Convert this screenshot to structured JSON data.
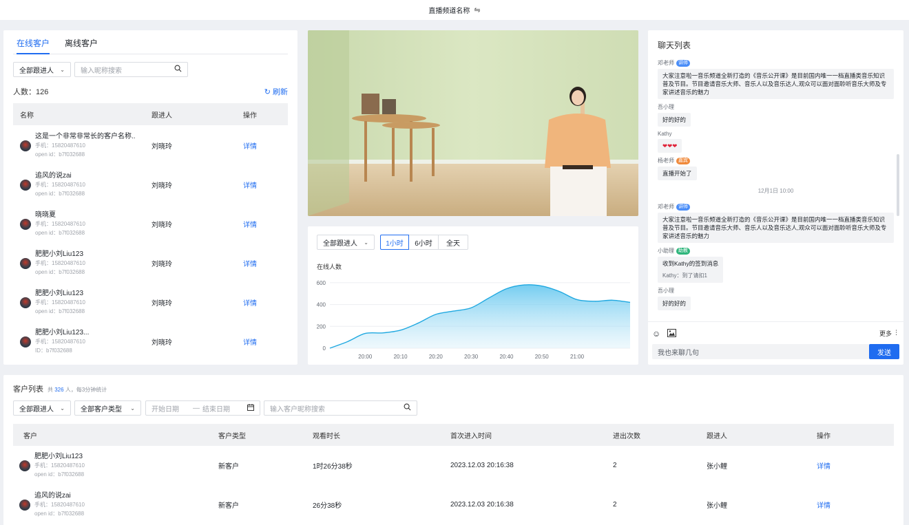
{
  "topbar": {
    "title": "直播频道名称",
    "switch_icon": "⇋"
  },
  "left": {
    "tabs": [
      "在线客户",
      "离线客户"
    ],
    "filter_select": "全部跟进人",
    "search_placeholder": "输入昵称搜索",
    "count_label": "人数：126",
    "refresh_label": "刷新",
    "headers": [
      "名称",
      "跟进人",
      "操作"
    ],
    "rows": [
      {
        "name": "这是一个非常非常长的客户名称..",
        "phone": "手机：15820487610",
        "openid": "open id：b7f032688",
        "follower": "刘晓玲",
        "action": "详情"
      },
      {
        "name": "追风的说zai",
        "phone": "手机：15820487610",
        "openid": "open id：b7f032688",
        "follower": "刘晓玲",
        "action": "详情"
      },
      {
        "name": "晓晓夏",
        "phone": "手机：15820487610",
        "openid": "open id：b7f032688",
        "follower": "刘晓玲",
        "action": "详情"
      },
      {
        "name": "肥肥小刘Liu123",
        "phone": "手机：15820487610",
        "openid": "open id：b7f032688",
        "follower": "刘晓玲",
        "action": "详情"
      },
      {
        "name": "肥肥小刘Liu123",
        "phone": "手机：15820487610",
        "openid": "open id：b7f032688",
        "follower": "刘晓玲",
        "action": "详情"
      },
      {
        "name": "肥肥小刘Liu123...",
        "phone": "手机：15820487610",
        "openid": "ID：b7f032688",
        "follower": "刘晓玲",
        "action": "详情"
      }
    ]
  },
  "chart_panel": {
    "filter_select": "全部跟进人",
    "segments": [
      "1小时",
      "6小时",
      "全天"
    ],
    "active_segment": "1小时"
  },
  "chart_data": {
    "type": "area",
    "title": "在线人数",
    "x_ticks": [
      "20:00",
      "20:10",
      "20:20",
      "20:30",
      "20:40",
      "20:50",
      "21:00"
    ],
    "y_ticks": [
      0,
      200,
      400,
      600
    ],
    "ylim": [
      0,
      650
    ],
    "x": [
      "19:50",
      "19:55",
      "20:00",
      "20:05",
      "20:10",
      "20:15",
      "20:20",
      "20:25",
      "20:30",
      "20:35",
      "20:40",
      "20:45",
      "20:50",
      "20:55",
      "21:00",
      "21:05",
      "21:10",
      "21:15"
    ],
    "values": [
      0,
      60,
      135,
      140,
      165,
      230,
      310,
      340,
      370,
      460,
      545,
      580,
      570,
      520,
      445,
      430,
      440,
      420
    ],
    "color": "#1fa8e0",
    "grid": true
  },
  "chat": {
    "title": "聊天列表",
    "messages": [
      {
        "name": "邓老师",
        "badge": "讲师",
        "badge_color": "#4a8df8",
        "text": "大家注意啦一音乐频道全新打造的《音乐公开课》是目前国内唯一一档直播类音乐知识普及节目。节目邀请音乐大师、音乐人以及音乐达人,观众可以面对面聆听音乐大师及专家讲述音乐的魅力"
      },
      {
        "name": "吾小理",
        "badge": "",
        "badge_color": "",
        "text": "好的好的"
      },
      {
        "name": "Kathy",
        "badge": "",
        "badge_color": "",
        "text": "❤❤❤"
      },
      {
        "name": "杨老师",
        "badge": "嘉宾",
        "badge_color": "#f08a3c",
        "text": "直播开始了"
      }
    ],
    "time_divider": "12月1日 10:00",
    "messages2": [
      {
        "name": "邓老师",
        "badge": "讲师",
        "badge_color": "#4a8df8",
        "text": "大家注意啦一音乐频道全新打造的《音乐公开课》是目前国内唯一一档直播类音乐知识普及节目。节目邀请音乐大师、音乐人以及音乐达人,观众可以面对面聆听音乐大师及专家讲述音乐的魅力"
      },
      {
        "name": "小助理",
        "badge": "助教",
        "badge_color": "#2fb67c",
        "text": "收到Kathy的签到消息",
        "extra": "Kathy：到了请扣1"
      },
      {
        "name": "吾小理",
        "badge": "",
        "badge_color": "",
        "text": "好的好的"
      }
    ],
    "more_label": "更多",
    "input_placeholder": "我也来聊几句",
    "send_label": "发送"
  },
  "bottom": {
    "title": "客户列表",
    "total_prefix": "共",
    "total": "326",
    "total_suffix": "人，每3分钟统计",
    "filter1": "全部跟进人",
    "filter2": "全部客户类型",
    "start_date": "开始日期",
    "date_sep": "—",
    "end_date": "结束日期",
    "search_placeholder": "输入客户昵称搜索",
    "headers": [
      "客户",
      "客户类型",
      "观看时长",
      "首次进入时间",
      "进出次数",
      "跟进人",
      "操作"
    ],
    "rows": [
      {
        "name": "肥肥小刘Liu123",
        "phone": "手机：15820487610",
        "openid": "open id：b7f032688",
        "type": "新客户",
        "duration": "1时26分38秒",
        "first": "2023.12.03 20:16:38",
        "times": "2",
        "follower": "张小鲤",
        "action": "详情"
      },
      {
        "name": "追风的说zai",
        "phone": "手机：15820487610",
        "openid": "open id：b7f032688",
        "type": "新客户",
        "duration": "26分38秒",
        "first": "2023.12.03 20:16:38",
        "times": "2",
        "follower": "张小鲤",
        "action": "详情"
      }
    ]
  }
}
